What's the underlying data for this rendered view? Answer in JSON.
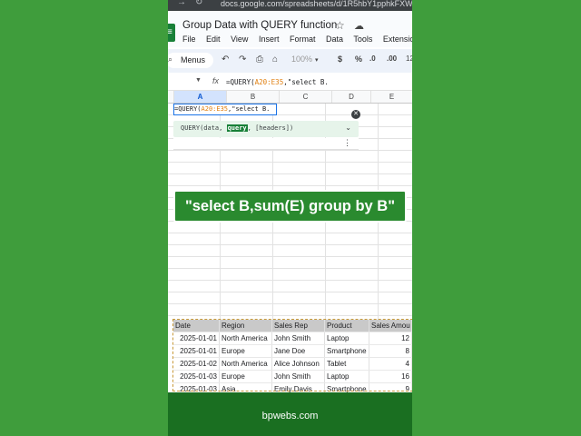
{
  "browser": {
    "url": "docs.google.com/spreadsheets/d/1R5hbY1pphkFXW"
  },
  "app": {
    "title": "Group Data with QUERY function",
    "menu": [
      "File",
      "Edit",
      "View",
      "Insert",
      "Format",
      "Data",
      "Tools",
      "Extensions"
    ]
  },
  "toolbar": {
    "menus_label": "Menus",
    "zoom": "100%",
    "currency": "$",
    "percent": "%",
    "dec_decrease": ".0",
    "dec_increase": ".00",
    "more": "12"
  },
  "formula_bar": {
    "fx": "fx",
    "prefix": "=QUERY(",
    "range": "A20:E35",
    "suffix": ",\"select B."
  },
  "columns": [
    "A",
    "B",
    "C",
    "D",
    "E"
  ],
  "active_cell": {
    "prefix": "=QUERY(",
    "range": "A20:E35",
    "suffix": ",\"select B."
  },
  "function_hint": {
    "prefix": "QUERY(data, ",
    "highlight": "query",
    "suffix": ", [headers])"
  },
  "overlay_text": "\"select B,sum(E) group by B\"",
  "table": {
    "headers": [
      "Date",
      "Region",
      "Sales Rep",
      "Product",
      "Sales Amou"
    ],
    "rows": [
      [
        "2025-01-01",
        "North America",
        "John Smith",
        "Laptop",
        "12"
      ],
      [
        "2025-01-01",
        "Europe",
        "Jane Doe",
        "Smartphone",
        "8"
      ],
      [
        "2025-01-02",
        "North America",
        "Alice Johnson",
        "Tablet",
        "4"
      ],
      [
        "2025-01-03",
        "Europe",
        "John Smith",
        "Laptop",
        "16"
      ],
      [
        "2025-01-03",
        "Asia",
        "Emily Davis",
        "Smartphone",
        "9"
      ]
    ]
  },
  "footer": "bpwebs.com"
}
